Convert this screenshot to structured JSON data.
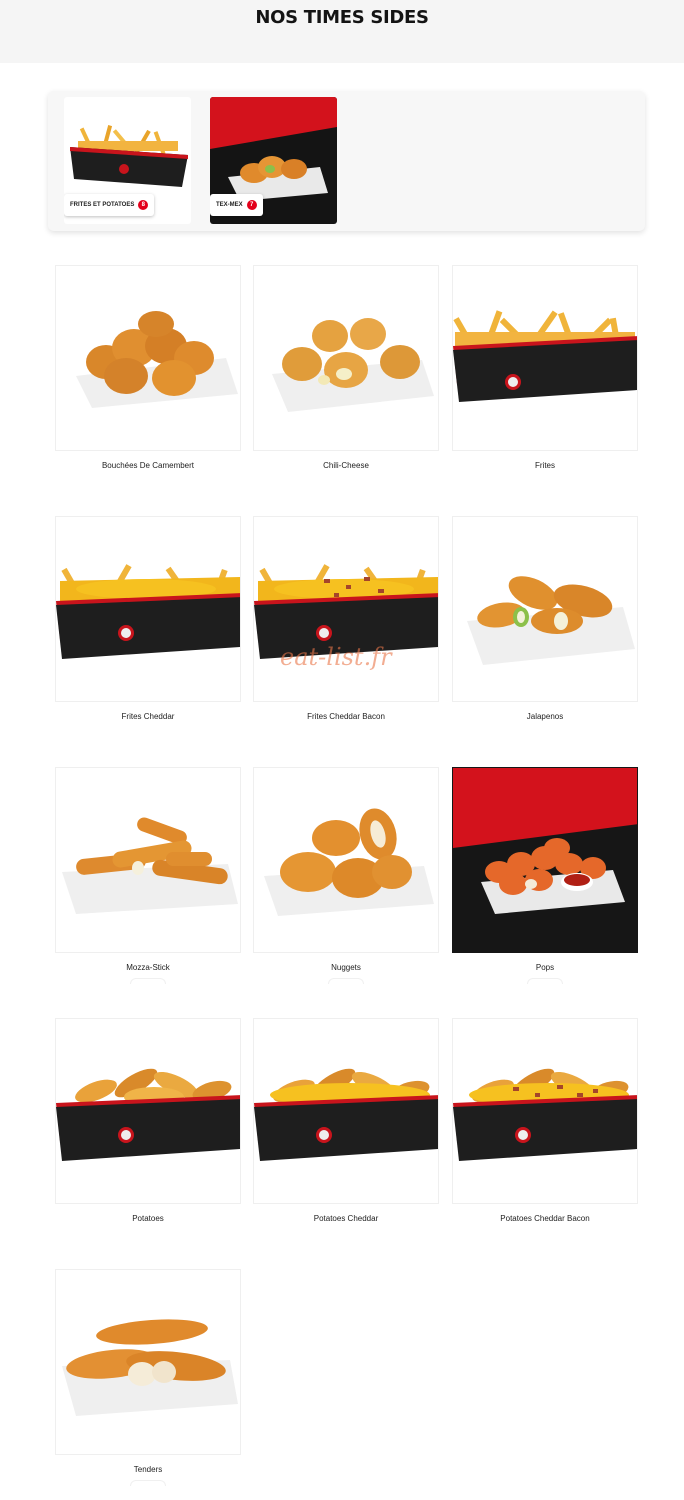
{
  "page": {
    "title": "NOS TIMES SIDES"
  },
  "categories": [
    {
      "label": "FRITES ET POTATOES",
      "count": "8"
    },
    {
      "label": "TEX-MEX",
      "count": "7"
    }
  ],
  "products": [
    {
      "name": "Bouchées De Camembert",
      "icon": "camembert-bites-image"
    },
    {
      "name": "Chili-Cheese",
      "icon": "chili-cheese-image"
    },
    {
      "name": "Frites",
      "icon": "fries-image"
    },
    {
      "name": "Frites Cheddar",
      "icon": "cheddar-fries-image"
    },
    {
      "name": "Frites Cheddar Bacon",
      "icon": "cheddar-bacon-fries-image"
    },
    {
      "name": "Jalapenos",
      "icon": "jalapenos-image"
    },
    {
      "name": "Mozza-Stick",
      "icon": "mozza-stick-image"
    },
    {
      "name": "Nuggets",
      "icon": "nuggets-image"
    },
    {
      "name": "Pops",
      "icon": "pops-image"
    },
    {
      "name": "Potatoes",
      "icon": "potatoes-image"
    },
    {
      "name": "Potatoes Cheddar",
      "icon": "potatoes-cheddar-image"
    },
    {
      "name": "Potatoes Cheddar Bacon",
      "icon": "potatoes-cheddar-bacon-image"
    },
    {
      "name": "Tenders",
      "icon": "tenders-image"
    }
  ],
  "watermark": "eat-list.fr",
  "colors": {
    "accent": "#e3001b",
    "box": "#1c1c1c",
    "fried": "#e08a2c",
    "cheddar": "#f2b21a"
  }
}
